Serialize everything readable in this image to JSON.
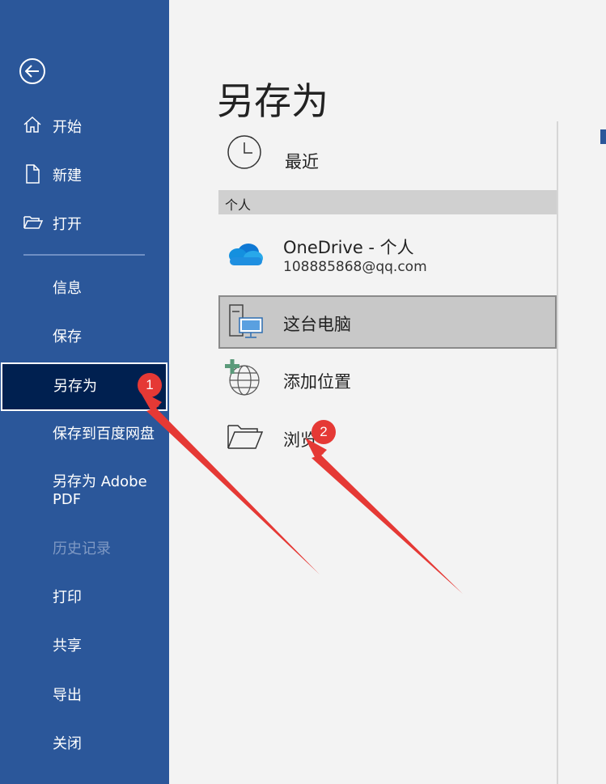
{
  "sidebar": {
    "back": "back",
    "top_items": [
      {
        "label": "开始",
        "icon": "home-icon"
      },
      {
        "label": "新建",
        "icon": "new-document-icon"
      },
      {
        "label": "打开",
        "icon": "open-folder-icon"
      }
    ],
    "items": [
      {
        "label": "信息"
      },
      {
        "label": "保存"
      },
      {
        "label": "另存为",
        "selected": true
      },
      {
        "label": "保存到百度网盘"
      },
      {
        "label": "另存为 Adobe PDF"
      },
      {
        "label": "历史记录",
        "disabled": true
      },
      {
        "label": "打印"
      },
      {
        "label": "共享"
      },
      {
        "label": "导出"
      },
      {
        "label": "关闭"
      }
    ]
  },
  "main": {
    "title": "另存为",
    "recent_label": "最近",
    "section_personal": "个人",
    "onedrive": {
      "label": "OneDrive - 个人",
      "account": "108885868@qq.com"
    },
    "this_pc_label": "这台电脑",
    "add_place_label": "添加位置",
    "browse_label": "浏览"
  },
  "annotations": {
    "badge_1": "1",
    "badge_2": "2",
    "color": "#e53935"
  },
  "colors": {
    "sidebar": "#2b579a",
    "selected": "#002050",
    "background": "#f3f3f3"
  }
}
